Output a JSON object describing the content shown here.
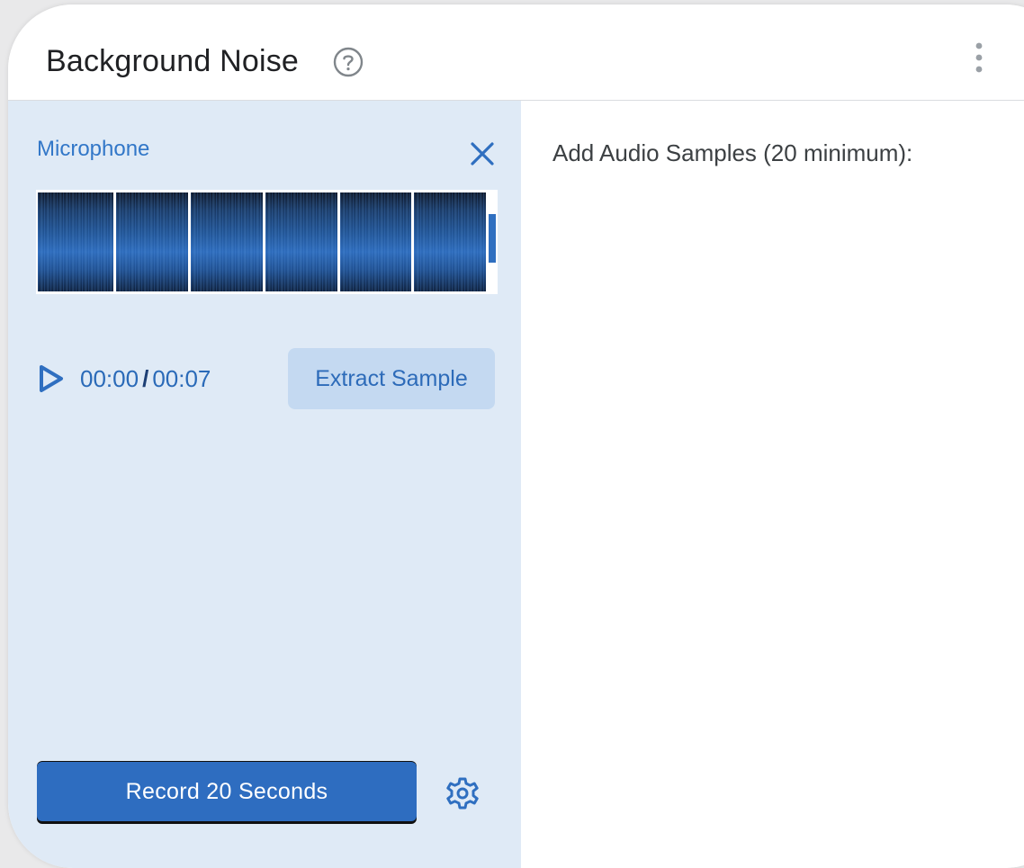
{
  "header": {
    "title": "Background Noise",
    "help_icon": "help-circle-icon",
    "menu_icon": "more-vert-icon"
  },
  "recorder": {
    "source_label": "Microphone",
    "close_icon": "close-icon",
    "playback": {
      "play_icon": "play-icon",
      "current_time": "00:00",
      "separator": "/",
      "duration": "00:07"
    },
    "extract_label": "Extract Sample",
    "record_label": "Record 20 Seconds",
    "settings_icon": "gear-icon"
  },
  "samples": {
    "label": "Add Audio Samples (20 minimum):"
  },
  "colors": {
    "accent": "#2e6dc0",
    "panel_bg": "#dfeaf6",
    "extract_bg": "#c4d9f1"
  }
}
